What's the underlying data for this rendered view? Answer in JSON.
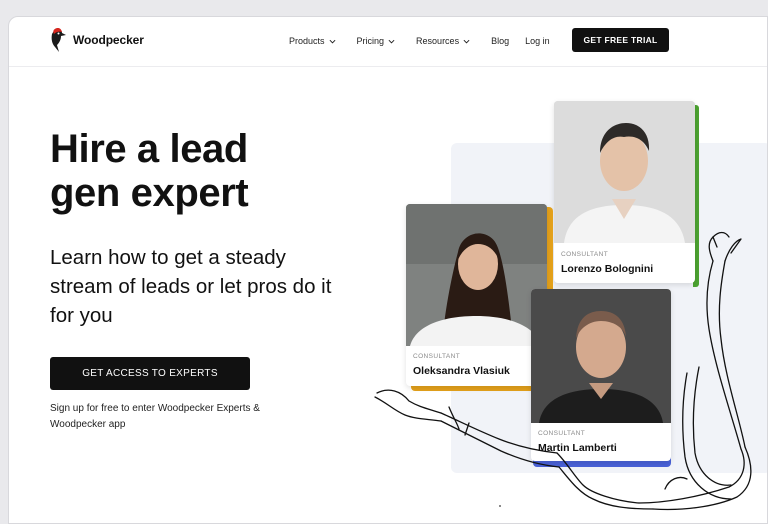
{
  "brand": {
    "name": "Woodpecker",
    "accent": "#d7261e"
  },
  "nav": {
    "items": [
      {
        "label": "Products",
        "dropdown": true
      },
      {
        "label": "Pricing",
        "dropdown": true
      },
      {
        "label": "Resources",
        "dropdown": true
      },
      {
        "label": "Blog",
        "dropdown": false
      },
      {
        "label": "Log in",
        "dropdown": false
      }
    ],
    "trial_button": "GET FREE TRIAL"
  },
  "hero": {
    "title": "Hire a lead gen expert",
    "subtitle": "Learn how to get a steady stream of leads or let pros do it for you",
    "cta": "GET ACCESS TO EXPERTS",
    "note": "Sign up for free to enter Woodpecker Experts & Woodpecker app"
  },
  "consultants": [
    {
      "role": "CONSULTANT",
      "name": "Lorenzo Bolognini",
      "accent": "#4ca331"
    },
    {
      "role": "CONSULTANT",
      "name": "Oleksandra Vlasiuk",
      "accent": "#e4a11b"
    },
    {
      "role": "CONSULTANT",
      "name": "Martin Lamberti",
      "accent": "#4a62d8"
    }
  ]
}
